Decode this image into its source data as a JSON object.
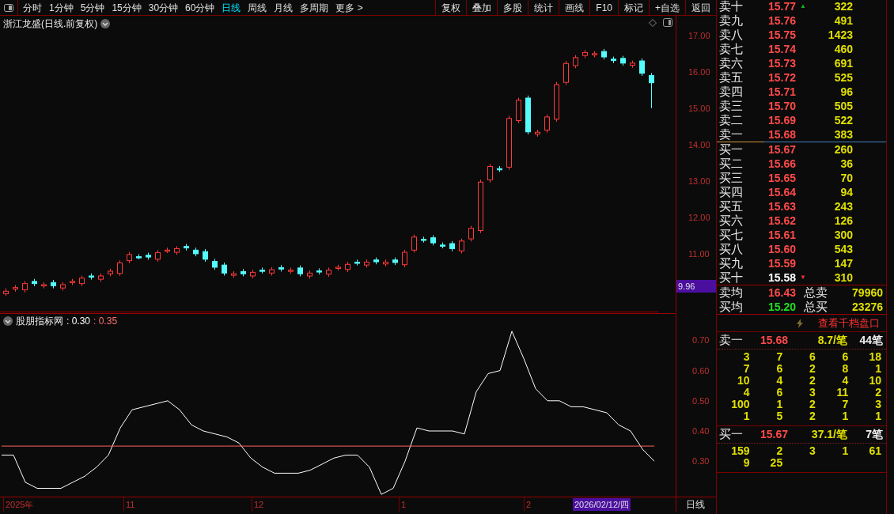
{
  "toolbar": {
    "periods": [
      {
        "label": "分时",
        "selected": false
      },
      {
        "label": "1分钟",
        "selected": false
      },
      {
        "label": "5分钟",
        "selected": false
      },
      {
        "label": "15分钟",
        "selected": false
      },
      {
        "label": "30分钟",
        "selected": false
      },
      {
        "label": "60分钟",
        "selected": false
      },
      {
        "label": "日线",
        "selected": true
      },
      {
        "label": "周线",
        "selected": false
      },
      {
        "label": "月线",
        "selected": false
      },
      {
        "label": "多周期",
        "selected": false
      },
      {
        "label": "更多 >",
        "selected": false
      }
    ],
    "buttons": [
      "复权",
      "叠加",
      "多股",
      "统计",
      "画线",
      "F10",
      "标记",
      "+自选",
      "返回"
    ]
  },
  "chart": {
    "title": "浙江龙盛(日线.前复权)",
    "low_label": "9.96",
    "chart_data": {
      "type": "candlestick",
      "ylim": [
        9.39,
        17.54
      ],
      "yticks": [
        {
          "value": 17,
          "label": "17.00"
        },
        {
          "value": 16,
          "label": "16.00"
        },
        {
          "value": 15,
          "label": "15.00"
        },
        {
          "value": 14,
          "label": "14.00"
        },
        {
          "value": 13,
          "label": "13.00"
        },
        {
          "value": 12,
          "label": "12.00"
        },
        {
          "value": 11,
          "label": "11.00"
        }
      ],
      "ohlc": [
        [
          9.9,
          10.05,
          9.84,
          9.97
        ],
        [
          10.03,
          10.14,
          9.96,
          10.07
        ],
        [
          10.01,
          10.25,
          9.94,
          10.18
        ],
        [
          10.24,
          10.31,
          10.11,
          10.18
        ],
        [
          10.12,
          10.22,
          10.05,
          10.15
        ],
        [
          10.21,
          10.28,
          10.05,
          10.12
        ],
        [
          10.06,
          10.22,
          9.99,
          10.15
        ],
        [
          10.21,
          10.31,
          10.14,
          10.24
        ],
        [
          10.18,
          10.4,
          10.11,
          10.33
        ],
        [
          10.39,
          10.46,
          10.29,
          10.36
        ],
        [
          10.3,
          10.46,
          10.23,
          10.39
        ],
        [
          10.45,
          10.59,
          10.38,
          10.52
        ],
        [
          10.46,
          10.82,
          10.39,
          10.75
        ],
        [
          10.81,
          11.05,
          10.74,
          10.98
        ],
        [
          10.92,
          10.99,
          10.85,
          10.9
        ],
        [
          10.96,
          11.03,
          10.84,
          10.91
        ],
        [
          10.85,
          11.1,
          10.78,
          11.03
        ],
        [
          11.09,
          11.17,
          11.02,
          11.1
        ],
        [
          11.04,
          11.21,
          10.97,
          11.14
        ],
        [
          11.2,
          11.27,
          11.09,
          11.16
        ],
        [
          11.1,
          11.17,
          10.93,
          11.0
        ],
        [
          11.06,
          11.13,
          10.78,
          10.85
        ],
        [
          10.79,
          10.86,
          10.56,
          10.63
        ],
        [
          10.69,
          10.76,
          10.4,
          10.47
        ],
        [
          10.41,
          10.52,
          10.34,
          10.45
        ],
        [
          10.51,
          10.58,
          10.38,
          10.45
        ],
        [
          10.39,
          10.56,
          10.32,
          10.49
        ],
        [
          10.55,
          10.62,
          10.46,
          10.53
        ],
        [
          10.47,
          10.63,
          10.4,
          10.56
        ],
        [
          10.62,
          10.69,
          10.51,
          10.58
        ],
        [
          10.52,
          10.62,
          10.45,
          10.55
        ],
        [
          10.61,
          10.68,
          10.38,
          10.45
        ],
        [
          10.39,
          10.54,
          10.32,
          10.47
        ],
        [
          10.53,
          10.6,
          10.43,
          10.5
        ],
        [
          10.44,
          10.62,
          10.37,
          10.55
        ],
        [
          10.61,
          10.7,
          10.54,
          10.63
        ],
        [
          10.57,
          10.78,
          10.5,
          10.71
        ],
        [
          10.77,
          10.84,
          10.68,
          10.75
        ],
        [
          10.69,
          10.84,
          10.62,
          10.77
        ],
        [
          10.83,
          10.9,
          10.71,
          10.78
        ],
        [
          10.72,
          10.84,
          10.65,
          10.77
        ],
        [
          10.83,
          10.9,
          10.69,
          10.76
        ],
        [
          10.7,
          11.11,
          10.63,
          11.04
        ],
        [
          11.1,
          11.53,
          11.03,
          11.46
        ],
        [
          11.4,
          11.47,
          11.31,
          11.38
        ],
        [
          11.44,
          11.51,
          11.23,
          11.3
        ],
        [
          11.24,
          11.31,
          11.15,
          11.22
        ],
        [
          11.28,
          11.35,
          11.07,
          11.14
        ],
        [
          11.08,
          11.42,
          11.01,
          11.35
        ],
        [
          11.41,
          11.77,
          11.34,
          11.7
        ],
        [
          11.64,
          13.04,
          11.57,
          12.97
        ],
        [
          13.03,
          13.47,
          12.96,
          13.4
        ],
        [
          13.34,
          13.41,
          13.25,
          13.32
        ],
        [
          13.38,
          14.79,
          13.31,
          14.72
        ],
        [
          14.66,
          15.29,
          14.59,
          15.22
        ],
        [
          15.28,
          15.35,
          14.28,
          14.35
        ],
        [
          14.29,
          14.41,
          14.22,
          14.34
        ],
        [
          14.4,
          14.83,
          14.33,
          14.76
        ],
        [
          14.7,
          15.72,
          14.63,
          15.65
        ],
        [
          15.71,
          16.3,
          15.64,
          16.23
        ],
        [
          16.17,
          16.46,
          16.1,
          16.39
        ],
        [
          16.45,
          16.6,
          16.38,
          16.53
        ],
        [
          16.47,
          16.57,
          16.4,
          16.5
        ],
        [
          16.56,
          16.63,
          16.34,
          16.41
        ],
        [
          16.35,
          16.42,
          16.24,
          16.31
        ],
        [
          16.37,
          16.44,
          16.17,
          16.24
        ],
        [
          16.18,
          16.31,
          16.11,
          16.24
        ],
        [
          16.3,
          16.37,
          15.89,
          15.96
        ],
        [
          15.9,
          15.97,
          15.0,
          15.7
        ]
      ]
    }
  },
  "indicator": {
    "name": "股朋指标网",
    "readings": [
      {
        "text": ": 0.30",
        "color": "#ffffff"
      },
      {
        "text": ": 0.35",
        "color": "#ff7070"
      }
    ],
    "chart_data": {
      "type": "line",
      "ylim": [
        0.18,
        0.79
      ],
      "yticks": [
        {
          "value": 0.7,
          "label": "0.70"
        },
        {
          "value": 0.6,
          "label": "0.60"
        },
        {
          "value": 0.5,
          "label": "0.50"
        },
        {
          "value": 0.4,
          "label": "0.40"
        },
        {
          "value": 0.3,
          "label": "0.30"
        }
      ],
      "series": [
        {
          "color": "#ffffff",
          "values": [
            0.32,
            0.32,
            0.23,
            0.21,
            0.21,
            0.21,
            0.23,
            0.25,
            0.28,
            0.32,
            0.41,
            0.47,
            0.48,
            0.49,
            0.5,
            0.47,
            0.42,
            0.4,
            0.39,
            0.38,
            0.36,
            0.31,
            0.28,
            0.26,
            0.26,
            0.26,
            0.27,
            0.29,
            0.31,
            0.32,
            0.32,
            0.28,
            0.19,
            0.21,
            0.3,
            0.41,
            0.4,
            0.4,
            0.4,
            0.39,
            0.53,
            0.59,
            0.6,
            0.73,
            0.64,
            0.54,
            0.5,
            0.5,
            0.48,
            0.48,
            0.47,
            0.46,
            0.42,
            0.4,
            0.34,
            0.3
          ]
        },
        {
          "color": "#ff6060",
          "values": [
            0.35,
            0.35,
            0.35,
            0.35,
            0.35,
            0.35,
            0.35,
            0.35,
            0.35,
            0.35,
            0.35,
            0.35,
            0.35,
            0.35,
            0.35,
            0.35,
            0.35,
            0.35,
            0.35,
            0.35,
            0.35,
            0.35,
            0.35,
            0.35,
            0.35,
            0.35,
            0.35,
            0.35,
            0.35,
            0.35,
            0.35,
            0.35,
            0.35,
            0.35,
            0.35,
            0.35,
            0.35,
            0.35,
            0.35,
            0.35,
            0.35,
            0.35,
            0.35,
            0.35,
            0.35,
            0.35,
            0.35,
            0.35,
            0.35,
            0.35,
            0.35,
            0.35,
            0.35,
            0.35,
            0.35,
            0.35
          ]
        }
      ]
    }
  },
  "time_axis": {
    "labels": [
      "2025年",
      "11",
      "12",
      "1",
      "2"
    ],
    "cursor_date": "2026/02/12/四",
    "period": "日线"
  },
  "order_book": {
    "asks": [
      {
        "label": "卖十",
        "price": "15.77",
        "volume": "322",
        "color": "#ff4a4a",
        "arrow": "▲"
      },
      {
        "label": "卖九",
        "price": "15.76",
        "volume": "491",
        "color": "#ff4a4a"
      },
      {
        "label": "卖八",
        "price": "15.75",
        "volume": "1423",
        "color": "#ff4a4a"
      },
      {
        "label": "卖七",
        "price": "15.74",
        "volume": "460",
        "color": "#ff4a4a"
      },
      {
        "label": "卖六",
        "price": "15.73",
        "volume": "691",
        "color": "#ff4a4a"
      },
      {
        "label": "卖五",
        "price": "15.72",
        "volume": "525",
        "color": "#ff4a4a"
      },
      {
        "label": "卖四",
        "price": "15.71",
        "volume": "96",
        "color": "#ff4a4a"
      },
      {
        "label": "卖三",
        "price": "15.70",
        "volume": "505",
        "color": "#ff4a4a"
      },
      {
        "label": "卖二",
        "price": "15.69",
        "volume": "522",
        "color": "#ff4a4a"
      },
      {
        "label": "卖一",
        "price": "15.68",
        "volume": "383",
        "color": "#ff4a4a"
      }
    ],
    "bids": [
      {
        "label": "买一",
        "price": "15.67",
        "volume": "260",
        "color": "#ff4a4a"
      },
      {
        "label": "买二",
        "price": "15.66",
        "volume": "36",
        "color": "#ff4a4a"
      },
      {
        "label": "买三",
        "price": "15.65",
        "volume": "70",
        "color": "#ff4a4a"
      },
      {
        "label": "买四",
        "price": "15.64",
        "volume": "94",
        "color": "#ff4a4a"
      },
      {
        "label": "买五",
        "price": "15.63",
        "volume": "243",
        "color": "#ff4a4a"
      },
      {
        "label": "买六",
        "price": "15.62",
        "volume": "126",
        "color": "#ff4a4a"
      },
      {
        "label": "买七",
        "price": "15.61",
        "volume": "300",
        "color": "#ff4a4a"
      },
      {
        "label": "买八",
        "price": "15.60",
        "volume": "543",
        "color": "#ff4a4a"
      },
      {
        "label": "买九",
        "price": "15.59",
        "volume": "147",
        "color": "#ff4a4a"
      },
      {
        "label": "买十",
        "price": "15.58",
        "volume": "310",
        "color": "#ffffff",
        "arrow": "▼"
      }
    ],
    "summary": [
      {
        "label": "卖均",
        "price": "16.43",
        "color": "#ff4a4a",
        "total_label": "总卖",
        "total": "79960"
      },
      {
        "label": "买均",
        "price": "15.20",
        "color": "#22dd22",
        "total_label": "总买",
        "total": "23276"
      }
    ],
    "depth_link": "查看千档盘口",
    "queues": [
      {
        "label": "卖一",
        "price": "15.68",
        "average": "8.7/笔",
        "count": "44笔",
        "orders": [
          "3",
          "7",
          "6",
          "6",
          "18",
          "7",
          "6",
          "2",
          "8",
          "1",
          "10",
          "4",
          "2",
          "4",
          "10",
          "4",
          "6",
          "3",
          "11",
          "2",
          "100",
          "1",
          "2",
          "7",
          "3",
          "1",
          "5",
          "2",
          "1",
          "1"
        ]
      },
      {
        "label": "买一",
        "price": "15.67",
        "average": "37.1/笔",
        "count": "7笔",
        "orders": [
          "159",
          "2",
          "3",
          "1",
          "61",
          "9",
          "25"
        ]
      }
    ]
  }
}
